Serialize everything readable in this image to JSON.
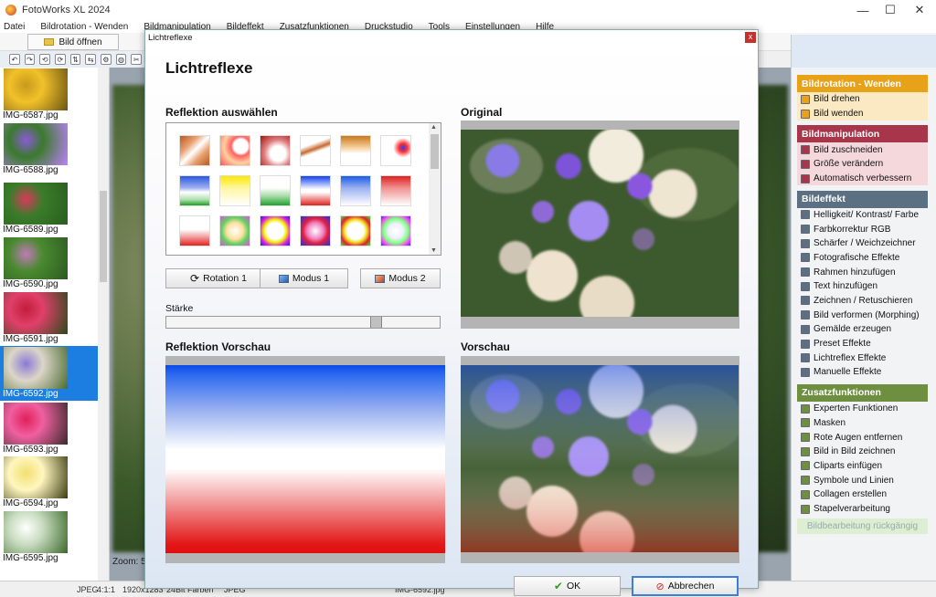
{
  "app": {
    "title": "FotoWorks XL 2024"
  },
  "window_controls": {
    "minimize": "—",
    "maximize": "☐",
    "close": "✕"
  },
  "menu": [
    "Datei",
    "Bildrotation - Wenden",
    "Bildmanipulation",
    "Bildeffekt",
    "Zusatzfunktionen",
    "Druckstudio",
    "Tools",
    "Einstellungen",
    "Hilfe"
  ],
  "toolbar": {
    "open_label": "Bild öffnen",
    "icons": [
      "rotate-left-icon",
      "rotate-right-icon",
      "rotate-ccw-icon",
      "rotate-cw-icon",
      "flip-icon",
      "mirror-icon",
      "settings-icon",
      "globe-icon",
      "cut-icon",
      "crop-icon"
    ]
  },
  "thumbnails": [
    {
      "label": "IMG-6587.jpg",
      "colors": [
        "#c79a1c",
        "#f2c12a",
        "#6a5412"
      ]
    },
    {
      "label": "IMG-6588.jpg",
      "colors": [
        "#8a5ad6",
        "#3b7a2c",
        "#c080ff"
      ]
    },
    {
      "label": "IMG-6589.jpg",
      "colors": [
        "#d83a5a",
        "#3a7c2a",
        "#2a5e1e"
      ]
    },
    {
      "label": "IMG-6590.jpg",
      "colors": [
        "#c07ab8",
        "#4a8a30",
        "#2c5a20"
      ]
    },
    {
      "label": "IMG-6591.jpg",
      "colors": [
        "#c21d3a",
        "#e0406a",
        "#2a4a1a"
      ]
    },
    {
      "label": "IMG-6592.jpg",
      "colors": [
        "#8a7ad6",
        "#dcd6c8",
        "#4a6a30"
      ]
    },
    {
      "label": "IMG-6593.jpg",
      "colors": [
        "#e0205a",
        "#f060a0",
        "#3a2a2a"
      ]
    },
    {
      "label": "IMG-6594.jpg",
      "colors": [
        "#f2e070",
        "#fff6c0",
        "#3a3a10"
      ]
    },
    {
      "label": "IMG-6595.jpg",
      "colors": [
        "#ffffff",
        "#c8dcc0",
        "#3a6a2a"
      ]
    }
  ],
  "thumb_scroll_partial": "",
  "zoom_label": "Zoom: 5",
  "right_panel": {
    "groups": [
      {
        "title": "Bildrotation - Wenden",
        "color": "#e8a21a",
        "item_bg": "#fbe9c4",
        "items": [
          "Bild drehen",
          "Bild wenden"
        ]
      },
      {
        "title": "Bildmanipulation",
        "color": "#a8364a",
        "item_bg": "#f4d8dc",
        "items": [
          "Bild zuschneiden",
          "Größe verändern",
          "Automatisch verbessern"
        ]
      },
      {
        "title": "Bildeffekt",
        "color": "#5b7083",
        "item_bg": "#f2f3f5",
        "items": [
          "Helligkeit/ Kontrast/ Farbe",
          "Farbkorrektur RGB",
          "Schärfer / Weichzeichner",
          "Fotografische Effekte",
          "Rahmen hinzufügen",
          "Text hinzufügen",
          "Zeichnen / Retuschieren",
          "Bild verformen (Morphing)",
          "Gemälde erzeugen",
          "Preset Effekte",
          "Lichtreflex Effekte",
          "Manuelle Effekte"
        ]
      },
      {
        "title": "Zusatzfunktionen",
        "color": "#6d8f3f",
        "item_bg": "#f2f3f5",
        "items": [
          "Experten Funktionen",
          "Masken",
          "Rote Augen entfernen",
          "Bild in Bild zeichnen",
          "Cliparts einfügen",
          "Symbole und Linien",
          "Collagen erstellen",
          "Stapelverarbeitung"
        ]
      }
    ],
    "undo_label": "Bildbearbeitung rückgängig"
  },
  "status": {
    "fields": [
      "JPEG",
      "4:1:1",
      "1920x1283",
      "24Bit Farben",
      "JPEG",
      "IMG-6592.jpg"
    ]
  },
  "dialog": {
    "window_title": "Lichtreflexe",
    "close": "x",
    "heading": "Lichtreflexe",
    "select_section": "Reflektion auswählen",
    "original_section": "Original",
    "reflection_preview_section": "Reflektion Vorschau",
    "preview_section": "Vorschau",
    "buttons": {
      "rotation": "Rotation 1",
      "mode1": "Modus 1",
      "mode2": "Modus 2"
    },
    "strength_label": "Stärke",
    "strength_value": 0.78,
    "ok_label": "OK",
    "cancel_label": "Abbrechen",
    "reflections": [
      "linear-gradient(135deg,#b85a20 0%,#e8a070 30%,#fff 50%,#e8a070 70%,#b85a20 100%)",
      "radial-gradient(circle at 70% 35%,#fff 0%,#fff 25%,#ff6060 35%,#ffd0a0 60%,#ff5050 100%)",
      "radial-gradient(circle at 60% 60%,#fff 0%,#fff 30%,#e08080 55%,#a01010 100%)",
      "linear-gradient(160deg,#fff 0%,#fff 30%,#c86a30 45%,#fff 55%,#fff 100%)",
      "linear-gradient(to bottom,#c8781a 0%,#f8d0a0 40%,#fff 60%,#fff 100%)",
      "radial-gradient(circle at 75% 40%,#2a3cff 0%,#ff3030 15%,#fff 35%,#fff 100%)",
      "linear-gradient(to bottom,#2858e0 0%,#9fb0f0 40%,#fff 55%,#b0e0b0 80%,#20a020 100%)",
      "linear-gradient(to bottom,#ffe800 0%,#fff6a0 40%,#fff 100%)",
      "linear-gradient(to bottom,#fff 0%,#fff 40%,#a0d8a0 70%,#20a030 100%)",
      "linear-gradient(to bottom,#1040f0 0%,#fff 45%,#fff 55%,#e02020 100%)",
      "linear-gradient(to bottom,#1a5ce8 0%,#9ab0f0 40%,#fff 100%)",
      "linear-gradient(to bottom,#e02020 0%,#f09090 40%,#fff 100%)",
      "linear-gradient(to bottom,#fff 0%,#fff 45%,#f0a0a0 70%,#e82020 100%)",
      "radial-gradient(circle at 50% 50%,#fff 0%,#ffe0a0 40%,#60d060 65%,#e050e0 100%)",
      "radial-gradient(circle at 50% 50%,#fff 0%,#fff 40%,#f0f000 55%,#e020e0 75%,#2020f0 100%)",
      "radial-gradient(circle at 50% 50%,#fff 0%,#f080c0 40%,#e02040 60%,#2030e0 100%)",
      "radial-gradient(circle at 50% 50%,#fff 0%,#fff 40%,#f0e020 55%,#e02030 75%,#30f030 100%)",
      "radial-gradient(circle at 50% 50%,#fff 0%,#f0f0ff 35%,#80ff80 60%,#ff40ff 80%,#3030ff 100%)"
    ]
  }
}
